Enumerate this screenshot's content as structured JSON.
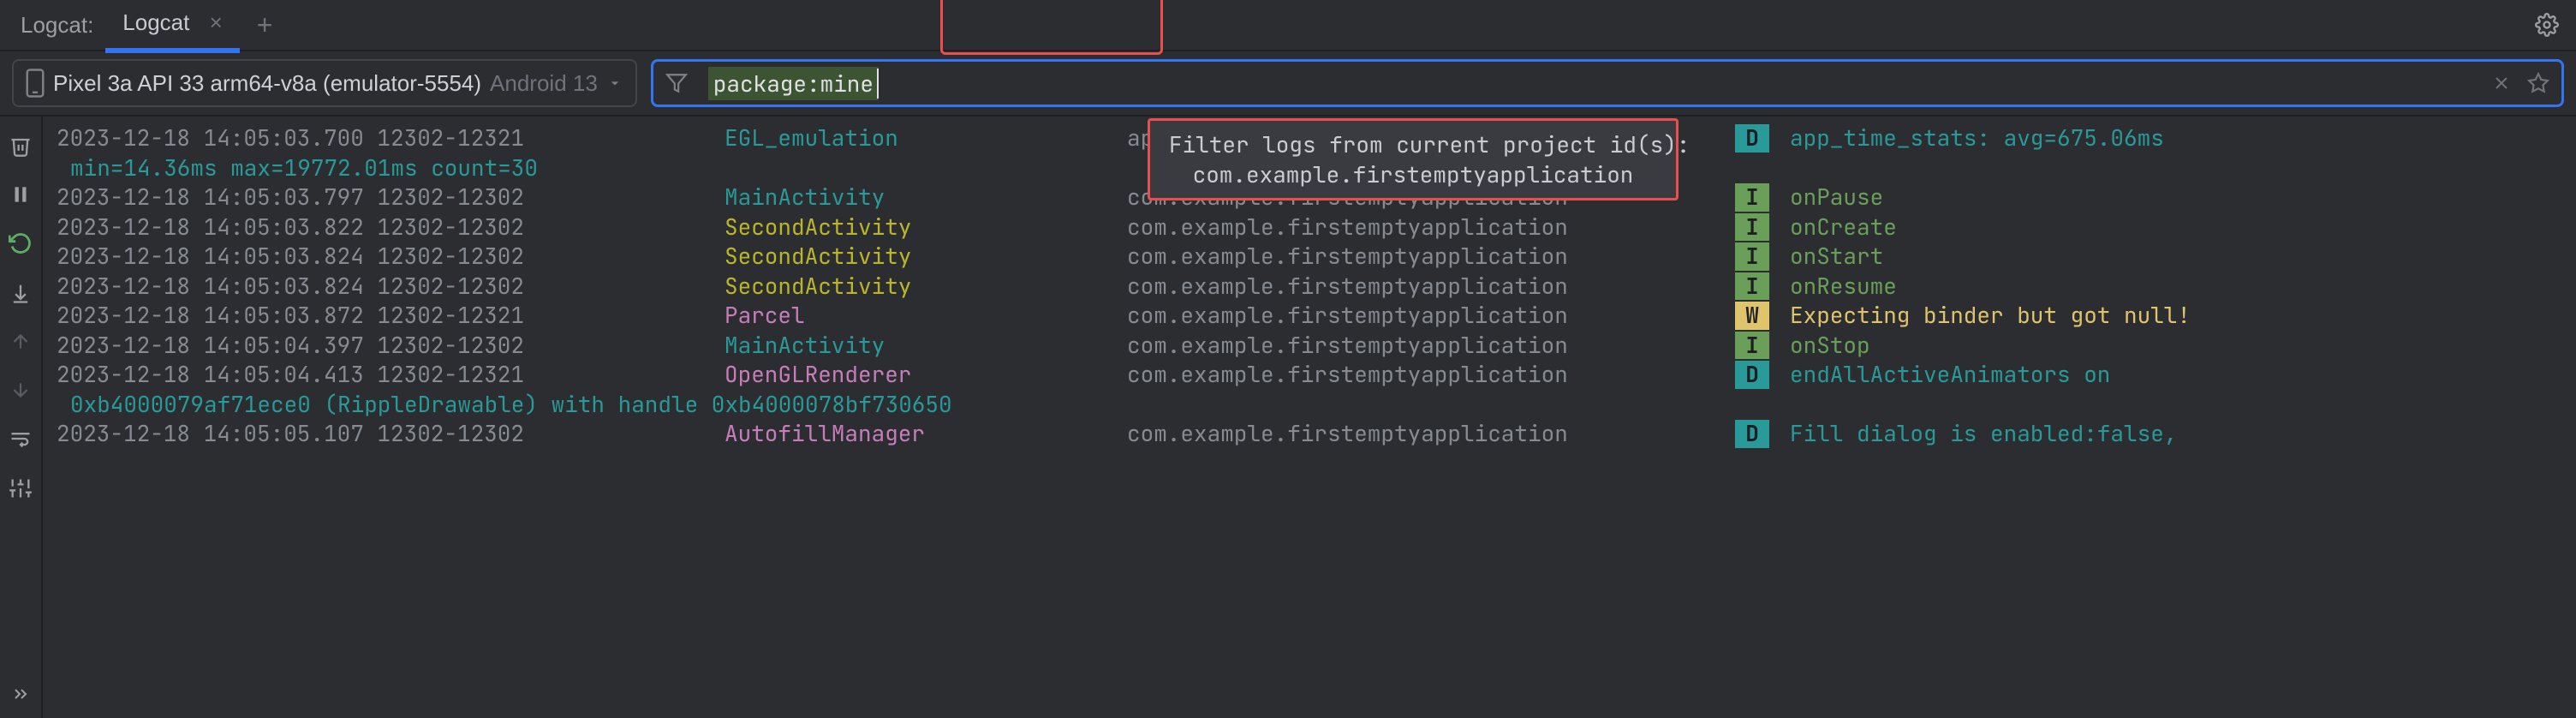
{
  "titlebar": {
    "label": "Logcat:",
    "tab_label": "Logcat",
    "tab_close": "×",
    "add": "+"
  },
  "device": {
    "name": "Pixel 3a API 33 arm64-v8a (emulator-5554)",
    "os": "Android 13"
  },
  "filter": {
    "text": "package:mine"
  },
  "tooltip": {
    "line1": "Filter logs from current project id(s):",
    "line2": "com.example.firstemptyapplication"
  },
  "logs": [
    {
      "ts": "2023-12-18 14:05:03.700 12302-12321",
      "tag": "EGL_emulation",
      "tagcls": "c-tag-cyan",
      "pkg": "application",
      "lvl": "D",
      "lvlcls": "lvl-D",
      "msg": "app_time_stats: avg=675.06ms",
      "msgcls": "c-msg-cyan",
      "cont": "min=14.36ms max=19772.01ms count=30"
    },
    {
      "ts": "2023-12-18 14:05:03.797 12302-12302",
      "tag": "MainActivity",
      "tagcls": "c-tag-cyan",
      "pkg": "com.example.firstemptyapplication",
      "lvl": "I",
      "lvlcls": "lvl-I",
      "msg": "onPause",
      "msgcls": "c-msg-green"
    },
    {
      "ts": "2023-12-18 14:05:03.822 12302-12302",
      "tag": "SecondActivity",
      "tagcls": "c-tag-yellow",
      "pkg": "com.example.firstemptyapplication",
      "lvl": "I",
      "lvlcls": "lvl-I",
      "msg": "onCreate",
      "msgcls": "c-msg-green"
    },
    {
      "ts": "2023-12-18 14:05:03.824 12302-12302",
      "tag": "SecondActivity",
      "tagcls": "c-tag-yellow",
      "pkg": "com.example.firstemptyapplication",
      "lvl": "I",
      "lvlcls": "lvl-I",
      "msg": "onStart",
      "msgcls": "c-msg-green"
    },
    {
      "ts": "2023-12-18 14:05:03.824 12302-12302",
      "tag": "SecondActivity",
      "tagcls": "c-tag-yellow",
      "pkg": "com.example.firstemptyapplication",
      "lvl": "I",
      "lvlcls": "lvl-I",
      "msg": "onResume",
      "msgcls": "c-msg-green"
    },
    {
      "ts": "2023-12-18 14:05:03.872 12302-12321",
      "tag": "Parcel",
      "tagcls": "c-tag-pink",
      "pkg": "com.example.firstemptyapplication",
      "lvl": "W",
      "lvlcls": "lvl-W",
      "msg": "Expecting binder but got null!",
      "msgcls": "c-msg-yellow"
    },
    {
      "ts": "2023-12-18 14:05:04.397 12302-12302",
      "tag": "MainActivity",
      "tagcls": "c-tag-cyan",
      "pkg": "com.example.firstemptyapplication",
      "lvl": "I",
      "lvlcls": "lvl-I",
      "msg": "onStop",
      "msgcls": "c-msg-green"
    },
    {
      "ts": "2023-12-18 14:05:04.413 12302-12321",
      "tag": "OpenGLRenderer",
      "tagcls": "c-tag-pink",
      "pkg": "com.example.firstemptyapplication",
      "lvl": "D",
      "lvlcls": "lvl-D",
      "msg": "endAllActiveAnimators on",
      "msgcls": "c-msg-cyan",
      "cont": "0xb4000079af71ece0 (RippleDrawable) with handle 0xb4000078bf730650"
    },
    {
      "ts": "2023-12-18 14:05:05.107 12302-12302",
      "tag": "AutofillManager",
      "tagcls": "c-tag-pink",
      "pkg": "com.example.firstemptyapplication",
      "lvl": "D",
      "lvlcls": "lvl-D",
      "msg": "Fill dialog is enabled:false,",
      "msgcls": "c-msg-cyan"
    }
  ]
}
